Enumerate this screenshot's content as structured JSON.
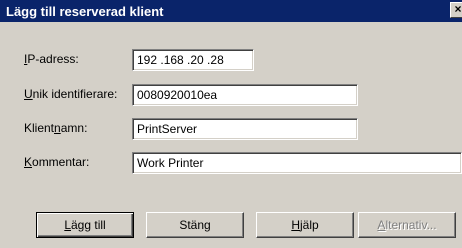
{
  "dialog": {
    "title": "Lägg till reserverad klient",
    "close_glyph": "×"
  },
  "fields": {
    "ip": {
      "label_pre": "",
      "label_ul": "I",
      "label_post": "P-adress:",
      "value": "192 .168 .20  .28"
    },
    "uid": {
      "label_pre": "",
      "label_ul": "U",
      "label_post": "nik identifierare:",
      "value": "0080920010ea"
    },
    "client": {
      "label_pre": "Klient",
      "label_ul": "n",
      "label_post": "amn:",
      "value": "PrintServer"
    },
    "comment": {
      "label_pre": "",
      "label_ul": "K",
      "label_post": "ommentar:",
      "value": "Work Printer"
    }
  },
  "buttons": {
    "add": {
      "pre": "",
      "ul": "L",
      "post": "ägg till"
    },
    "close": {
      "pre": "Stäng",
      "ul": "",
      "post": ""
    },
    "help": {
      "pre": "",
      "ul": "H",
      "post": "jälp"
    },
    "options": {
      "pre": "",
      "ul": "A",
      "post": "lternativ..."
    }
  }
}
